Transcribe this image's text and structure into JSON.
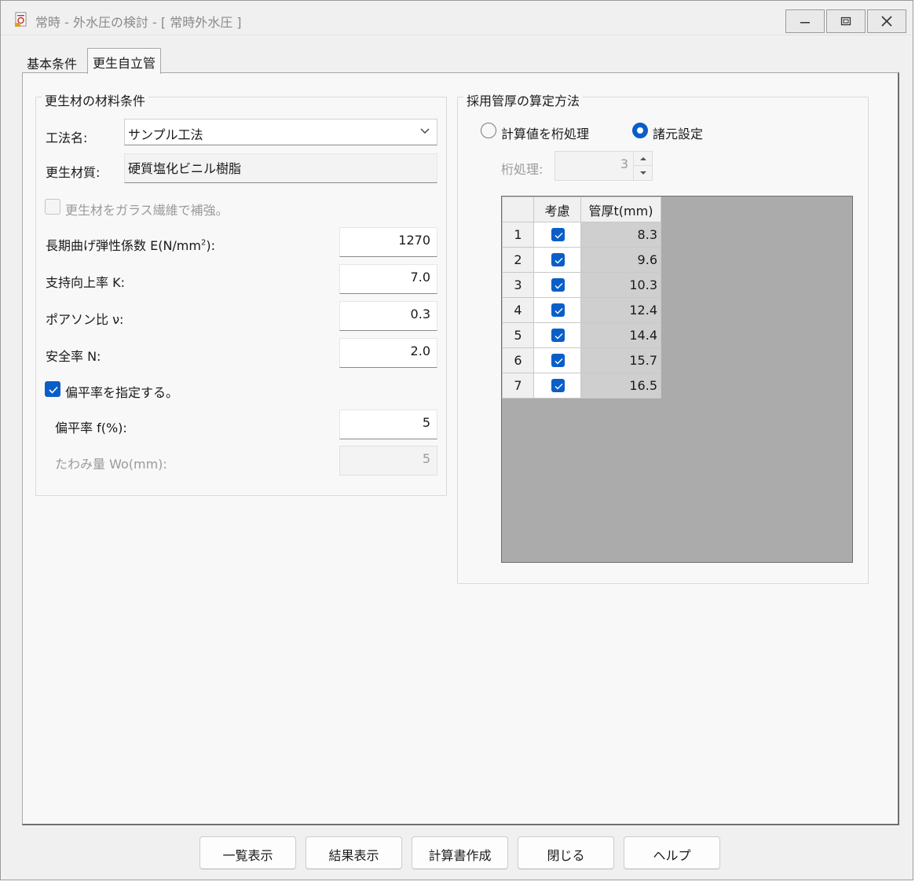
{
  "window": {
    "title": "常時 - 外水圧の検討 - [ 常時外水圧 ]"
  },
  "tabs": [
    {
      "label": "基本条件"
    },
    {
      "label": "更生自立管"
    }
  ],
  "material_group": {
    "title": "更生材の材料条件",
    "method_label": "工法名:",
    "method_value": "サンプル工法",
    "quality_label": "更生材質:",
    "quality_value": "硬質塩化ビニル樹脂",
    "glass_fiber_label": "更生材をガラス繊維で補強。",
    "glass_fiber_checked": false,
    "modulus_label": "長期曲げ弾性係数 E(N/mm",
    "modulus_sup": "2",
    "modulus_suffix": "):",
    "modulus_value": "1270",
    "support_label": "支持向上率 K:",
    "support_value": "7.0",
    "poisson_label": "ポアソン比 ν:",
    "poisson_value": "0.3",
    "safety_label": "安全率 N:",
    "safety_value": "2.0",
    "flatness_check_label": "偏平率を指定する。",
    "flatness_checked": true,
    "flatness_label": "偏平率 f(%):",
    "flatness_value": "5",
    "deflection_label": "たわみ量 Wo(mm):",
    "deflection_value": "5"
  },
  "thickness_group": {
    "title": "採用管厚の算定方法",
    "radio_calc_label": "計算値を桁処理",
    "radio_spec_label": "諸元設定",
    "selected": "諸元設定",
    "digits_label": "桁処理:",
    "digits_value": "3",
    "table": {
      "headers": [
        "考慮",
        "管厚t(mm)"
      ],
      "rows": [
        {
          "no": "1",
          "checked": true,
          "t": "8.3"
        },
        {
          "no": "2",
          "checked": true,
          "t": "9.6"
        },
        {
          "no": "3",
          "checked": true,
          "t": "10.3"
        },
        {
          "no": "4",
          "checked": true,
          "t": "12.4"
        },
        {
          "no": "5",
          "checked": true,
          "t": "14.4"
        },
        {
          "no": "6",
          "checked": true,
          "t": "15.7"
        },
        {
          "no": "7",
          "checked": true,
          "t": "16.5"
        }
      ]
    }
  },
  "buttons": {
    "list": "一覧表示",
    "result": "結果表示",
    "report": "計算書作成",
    "close": "閉じる",
    "help": "ヘルプ"
  },
  "colors": {
    "accent": "#0a5ec8",
    "grid_background": "#ababab",
    "disabled_text": "#9a9a9a"
  },
  "icons": {
    "app": "document-app-icon",
    "minimize": "minimize-icon",
    "maximize": "maximize-icon",
    "close": "close-icon",
    "dropdown": "chevron-down-icon"
  }
}
